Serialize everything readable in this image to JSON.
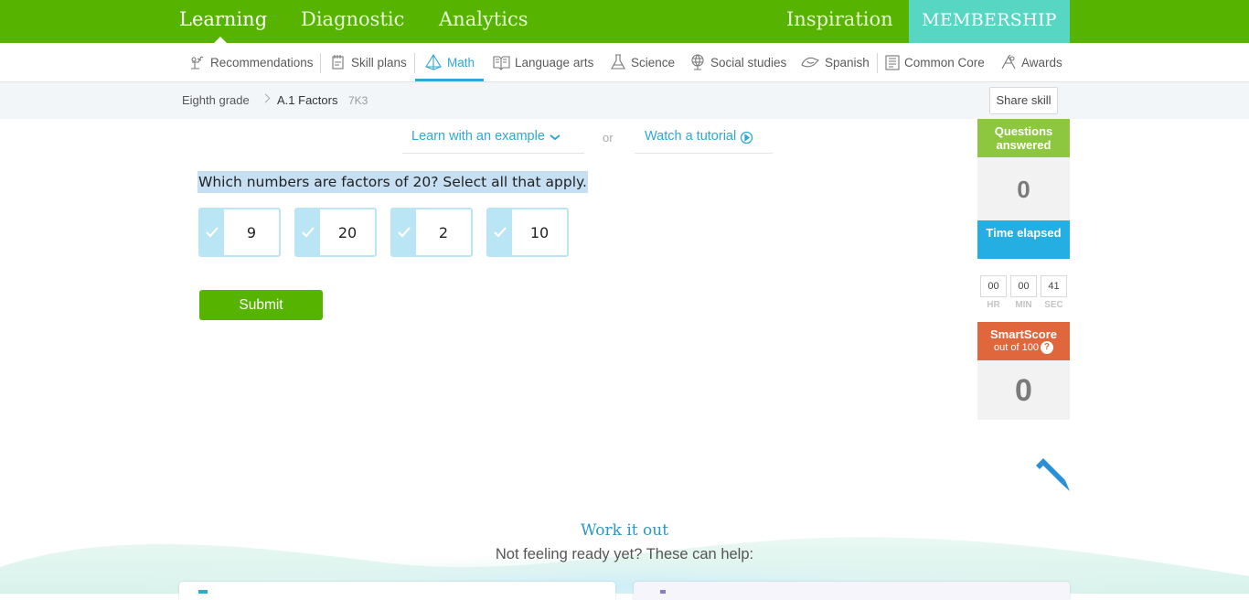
{
  "topnav": {
    "tabs": [
      "Learning",
      "Diagnostic",
      "Analytics"
    ],
    "inspiration": "Inspiration",
    "membership": "MEMBERSHIP"
  },
  "subnav": {
    "items": [
      "Recommendations",
      "Skill plans",
      "Math",
      "Language arts",
      "Science",
      "Social studies",
      "Spanish",
      "Common Core",
      "Awards"
    ],
    "active": "Math"
  },
  "breadcrumb": {
    "grade": "Eighth grade",
    "skill": "A.1 Factors",
    "code": "7K3",
    "share": "Share skill"
  },
  "help": {
    "learn": "Learn with an example",
    "or": "or",
    "tutorial": "Watch a tutorial"
  },
  "question": {
    "prompt": "Which numbers are factors of 20? Select all that apply.",
    "choices": [
      "9",
      "20",
      "2",
      "10"
    ],
    "submit": "Submit"
  },
  "stats": {
    "questions_label": "Questions answered",
    "questions_value": "0",
    "time_label": "Time elapsed",
    "hr": "00",
    "min": "00",
    "sec": "41",
    "hr_label": "HR",
    "min_label": "MIN",
    "sec_label": "SEC",
    "smartscore_label": "SmartScore",
    "smartscore_sub": "out of 100",
    "smartscore_help": "?",
    "smartscore_value": "0"
  },
  "workout": {
    "title": "Work it out",
    "subtitle": "Not feeling ready yet? These can help:"
  },
  "colors": {
    "green": "#56b400",
    "teal": "#57d6c4",
    "blue": "#2fa8d6",
    "questions_head": "#8dc63f",
    "time_head": "#25aee1",
    "smartscore_head": "#e0663c"
  },
  "icons": [
    "recommendations-icon",
    "skill-plans-icon",
    "math-icon",
    "language-arts-icon",
    "science-icon",
    "social-studies-icon",
    "spanish-icon",
    "common-core-icon",
    "awards-icon",
    "chevron-down-icon",
    "play-circle-icon",
    "check-icon",
    "pencil-icon"
  ]
}
